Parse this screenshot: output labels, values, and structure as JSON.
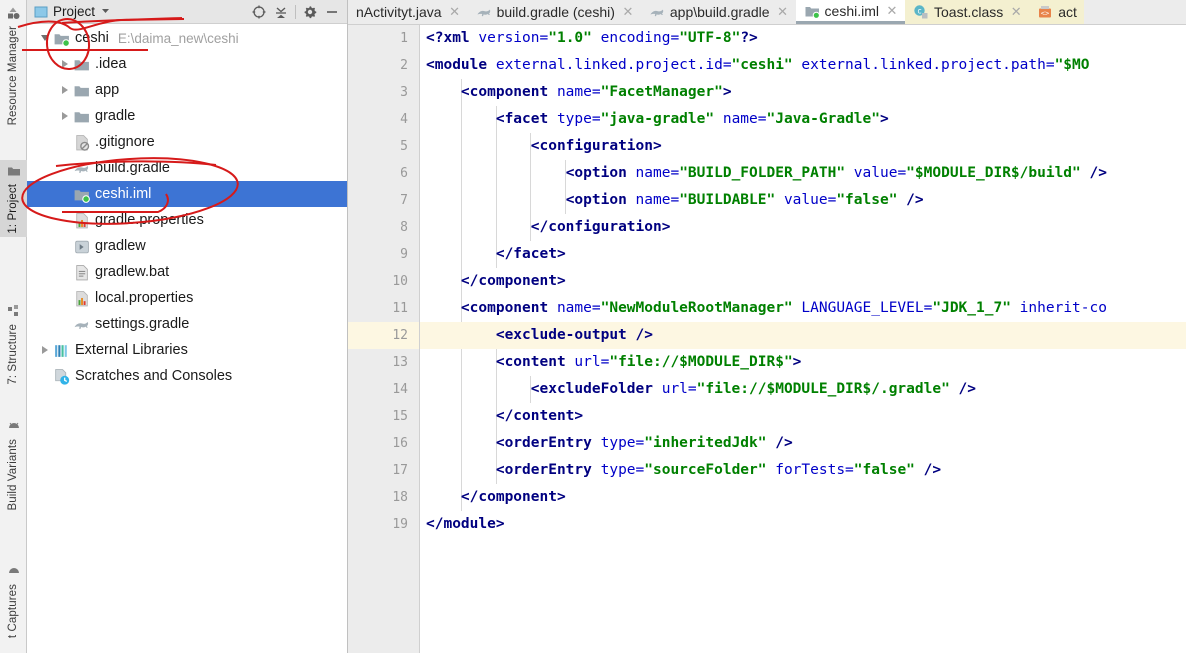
{
  "window": {
    "app": "IntelliJ IDEA / Android Studio",
    "accent_selection": "#3d74d4",
    "annotation_color": "#d61a1a",
    "caret_line_color": "#fdf7e2"
  },
  "toolstrip": {
    "tabs": [
      {
        "label": "Resource Manager",
        "icon": "resource-manager-icon",
        "active": false
      },
      {
        "label": "1: Project",
        "icon": "folder-icon",
        "active": true
      },
      {
        "label": "7: Structure",
        "icon": "structure-icon",
        "active": false
      },
      {
        "label": "Build Variants",
        "icon": "android-icon",
        "active": false
      },
      {
        "label": "t Captures",
        "icon": "captures-icon",
        "active": false
      }
    ]
  },
  "project_panel": {
    "header": {
      "title": "Project",
      "view_icon": "project-view-icon",
      "dropdown_icon": "chevron-down-icon",
      "buttons": [
        {
          "name": "locate-button",
          "icon": "crosshair-icon"
        },
        {
          "name": "collapse-all-button",
          "icon": "collapse-all-icon"
        },
        {
          "name": "settings-button",
          "icon": "gear-icon"
        },
        {
          "name": "hide-button",
          "icon": "minus-icon"
        }
      ]
    },
    "tree": [
      {
        "label": "ceshi",
        "path": "E:\\daima_new\\ceshi",
        "icon": "module-icon",
        "indent": 0,
        "arrow": "down",
        "selected": false
      },
      {
        "label": ".idea",
        "path": "",
        "icon": "folder-icon",
        "indent": 1,
        "arrow": "right",
        "selected": false
      },
      {
        "label": "app",
        "path": "",
        "icon": "folder-icon",
        "indent": 1,
        "arrow": "right",
        "selected": false
      },
      {
        "label": "gradle",
        "path": "",
        "icon": "folder-icon",
        "indent": 1,
        "arrow": "right",
        "selected": false
      },
      {
        "label": ".gitignore",
        "path": "",
        "icon": "gitignore-icon",
        "indent": 1,
        "arrow": "none",
        "selected": false
      },
      {
        "label": "build.gradle",
        "path": "",
        "icon": "gradle-icon",
        "indent": 1,
        "arrow": "none",
        "selected": false
      },
      {
        "label": "ceshi.iml",
        "path": "",
        "icon": "module-icon",
        "indent": 1,
        "arrow": "none",
        "selected": true
      },
      {
        "label": "gradle.properties",
        "path": "",
        "icon": "properties-icon",
        "indent": 1,
        "arrow": "none",
        "selected": false
      },
      {
        "label": "gradlew",
        "path": "",
        "icon": "script-icon",
        "indent": 1,
        "arrow": "none",
        "selected": false
      },
      {
        "label": "gradlew.bat",
        "path": "",
        "icon": "bat-icon",
        "indent": 1,
        "arrow": "none",
        "selected": false
      },
      {
        "label": "local.properties",
        "path": "",
        "icon": "properties-icon",
        "indent": 1,
        "arrow": "none",
        "selected": false
      },
      {
        "label": "settings.gradle",
        "path": "",
        "icon": "gradle-icon",
        "indent": 1,
        "arrow": "none",
        "selected": false
      },
      {
        "label": "External Libraries",
        "path": "",
        "icon": "libraries-icon",
        "indent": 0,
        "arrow": "right",
        "selected": false
      },
      {
        "label": "Scratches and Consoles",
        "path": "",
        "icon": "scratches-icon",
        "indent": 0,
        "arrow": "none",
        "selected": false
      }
    ]
  },
  "editor": {
    "tabs": [
      {
        "label": "nActivityt.java",
        "icon": "java-icon",
        "closable": true,
        "active": false,
        "style": "plain",
        "truncated_left": true
      },
      {
        "label": "build.gradle (ceshi)",
        "icon": "gradle-icon",
        "closable": true,
        "active": false,
        "style": "plain"
      },
      {
        "label": "app\\build.gradle",
        "icon": "gradle-icon",
        "closable": true,
        "active": false,
        "style": "plain"
      },
      {
        "label": "ceshi.iml",
        "icon": "module-icon",
        "closable": true,
        "active": true,
        "style": "plain"
      },
      {
        "label": "Toast.class",
        "icon": "class-icon",
        "closable": true,
        "active": false,
        "style": "yellow"
      },
      {
        "label": "act",
        "icon": "xml-layout-icon",
        "closable": false,
        "active": false,
        "style": "yellow",
        "truncated_right": true
      }
    ],
    "caret_line": 12,
    "line_numbers": [
      1,
      2,
      3,
      4,
      5,
      6,
      7,
      8,
      9,
      10,
      11,
      12,
      13,
      14,
      15,
      16,
      17,
      18,
      19
    ],
    "lines": [
      {
        "n": 1,
        "indent": 0,
        "tokens": [
          {
            "t": "pi",
            "s": "<?xml "
          },
          {
            "t": "attr",
            "s": "version="
          },
          {
            "t": "val",
            "s": "\"1.0\""
          },
          {
            "t": "attr",
            "s": " encoding="
          },
          {
            "t": "val",
            "s": "\"UTF-8\""
          },
          {
            "t": "pi",
            "s": "?>"
          }
        ]
      },
      {
        "n": 2,
        "indent": 0,
        "tokens": [
          {
            "t": "tag",
            "s": "<module "
          },
          {
            "t": "attr",
            "s": "external.linked.project.id="
          },
          {
            "t": "val",
            "s": "\"ceshi\""
          },
          {
            "t": "attr",
            "s": " external.linked.project.path="
          },
          {
            "t": "val",
            "s": "\"$MO"
          }
        ]
      },
      {
        "n": 3,
        "indent": 1,
        "tokens": [
          {
            "t": "tag",
            "s": "<component "
          },
          {
            "t": "attr",
            "s": "name="
          },
          {
            "t": "val",
            "s": "\"FacetManager\""
          },
          {
            "t": "tag",
            "s": ">"
          }
        ]
      },
      {
        "n": 4,
        "indent": 2,
        "tokens": [
          {
            "t": "tag",
            "s": "<facet "
          },
          {
            "t": "attr",
            "s": "type="
          },
          {
            "t": "val",
            "s": "\"java-gradle\""
          },
          {
            "t": "attr",
            "s": " name="
          },
          {
            "t": "val",
            "s": "\"Java-Gradle\""
          },
          {
            "t": "tag",
            "s": ">"
          }
        ]
      },
      {
        "n": 5,
        "indent": 3,
        "tokens": [
          {
            "t": "tag",
            "s": "<configuration>"
          }
        ]
      },
      {
        "n": 6,
        "indent": 4,
        "tokens": [
          {
            "t": "tag",
            "s": "<option "
          },
          {
            "t": "attr",
            "s": "name="
          },
          {
            "t": "val",
            "s": "\"BUILD_FOLDER_PATH\""
          },
          {
            "t": "attr",
            "s": " value="
          },
          {
            "t": "val",
            "s": "\"$MODULE_DIR$/build\""
          },
          {
            "t": "tag",
            "s": " />"
          }
        ]
      },
      {
        "n": 7,
        "indent": 4,
        "tokens": [
          {
            "t": "tag",
            "s": "<option "
          },
          {
            "t": "attr",
            "s": "name="
          },
          {
            "t": "val",
            "s": "\"BUILDABLE\""
          },
          {
            "t": "attr",
            "s": " value="
          },
          {
            "t": "val",
            "s": "\"false\""
          },
          {
            "t": "tag",
            "s": " />"
          }
        ]
      },
      {
        "n": 8,
        "indent": 3,
        "tokens": [
          {
            "t": "tag",
            "s": "</configuration>"
          }
        ]
      },
      {
        "n": 9,
        "indent": 2,
        "tokens": [
          {
            "t": "tag",
            "s": "</facet>"
          }
        ]
      },
      {
        "n": 10,
        "indent": 1,
        "tokens": [
          {
            "t": "tag",
            "s": "</component>"
          }
        ]
      },
      {
        "n": 11,
        "indent": 1,
        "tokens": [
          {
            "t": "tag",
            "s": "<component "
          },
          {
            "t": "attr",
            "s": "name="
          },
          {
            "t": "val",
            "s": "\"NewModuleRootManager\""
          },
          {
            "t": "attr",
            "s": " LANGUAGE_LEVEL="
          },
          {
            "t": "val",
            "s": "\"JDK_1_7\""
          },
          {
            "t": "attr",
            "s": " inherit-co"
          }
        ]
      },
      {
        "n": 12,
        "indent": 2,
        "tokens": [
          {
            "t": "tag",
            "s": "<exclude-output />"
          }
        ]
      },
      {
        "n": 13,
        "indent": 2,
        "tokens": [
          {
            "t": "tag",
            "s": "<content "
          },
          {
            "t": "attr",
            "s": "url="
          },
          {
            "t": "val",
            "s": "\"file://$MODULE_DIR$\""
          },
          {
            "t": "tag",
            "s": ">"
          }
        ]
      },
      {
        "n": 14,
        "indent": 3,
        "tokens": [
          {
            "t": "tag",
            "s": "<excludeFolder "
          },
          {
            "t": "attr",
            "s": "url="
          },
          {
            "t": "val",
            "s": "\"file://$MODULE_DIR$/.gradle\""
          },
          {
            "t": "tag",
            "s": " />"
          }
        ]
      },
      {
        "n": 15,
        "indent": 2,
        "tokens": [
          {
            "t": "tag",
            "s": "</content>"
          }
        ]
      },
      {
        "n": 16,
        "indent": 2,
        "tokens": [
          {
            "t": "tag",
            "s": "<orderEntry "
          },
          {
            "t": "attr",
            "s": "type="
          },
          {
            "t": "val",
            "s": "\"inheritedJdk\""
          },
          {
            "t": "tag",
            "s": " />"
          }
        ]
      },
      {
        "n": 17,
        "indent": 2,
        "tokens": [
          {
            "t": "tag",
            "s": "<orderEntry "
          },
          {
            "t": "attr",
            "s": "type="
          },
          {
            "t": "val",
            "s": "\"sourceFolder\""
          },
          {
            "t": "attr",
            "s": " forTests="
          },
          {
            "t": "val",
            "s": "\"false\""
          },
          {
            "t": "tag",
            "s": " />"
          }
        ]
      },
      {
        "n": 18,
        "indent": 1,
        "tokens": [
          {
            "t": "tag",
            "s": "</component>"
          }
        ]
      },
      {
        "n": 19,
        "indent": 0,
        "tokens": [
          {
            "t": "tag",
            "s": "</module>"
          }
        ]
      }
    ]
  },
  "annotations": {
    "color": "#d61a1a",
    "shapes": [
      {
        "name": "circle-project-icon",
        "type": "ellipse"
      },
      {
        "name": "line-from-project-icon",
        "type": "line"
      },
      {
        "name": "circle-ceshi-iml",
        "type": "ellipse"
      },
      {
        "name": "line-to-ceshi-iml",
        "type": "line"
      }
    ]
  }
}
